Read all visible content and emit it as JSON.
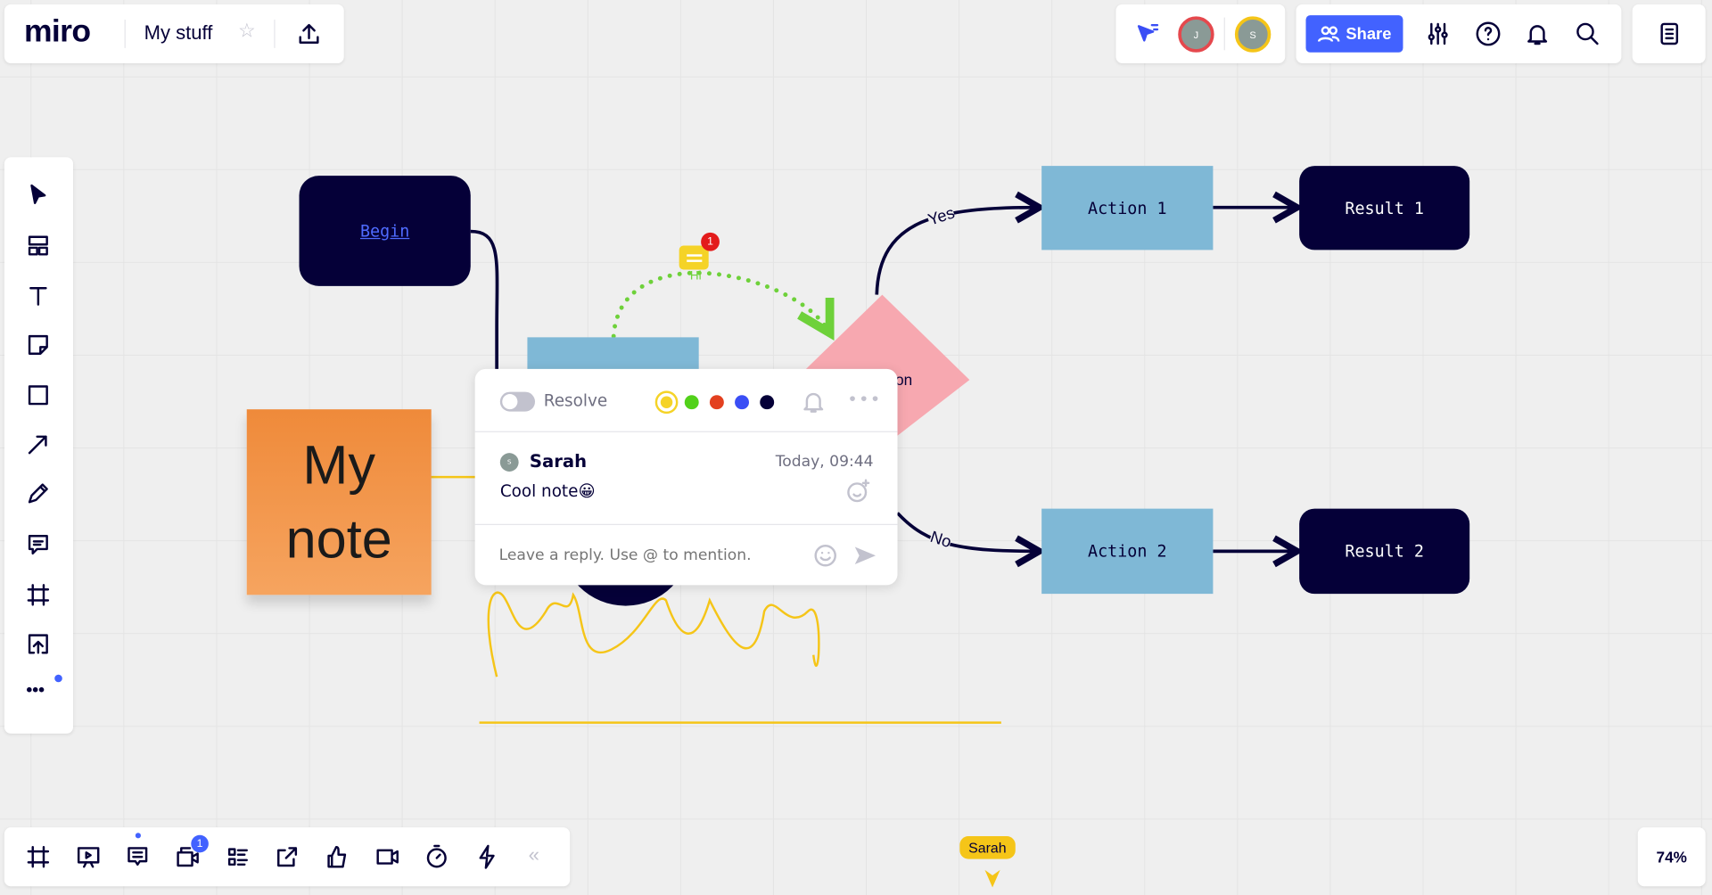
{
  "topbar": {
    "logo": "miro",
    "board_title": "My stuff",
    "star_icon": "star-icon",
    "export_icon": "upload-icon"
  },
  "collab": {
    "avatars": [
      {
        "initial": "J",
        "ring": "#e5484d"
      },
      {
        "initial": "S",
        "ring": "#f5c518"
      }
    ],
    "share_label": "Share"
  },
  "accent": "#4262ff",
  "left_toolbar": [
    "select",
    "templates",
    "text",
    "sticky-note",
    "shape",
    "arrow",
    "pen",
    "comment",
    "frame",
    "upload",
    "more"
  ],
  "bottom_toolbar": {
    "items": [
      "frame",
      "presentation",
      "comments",
      "video-chat",
      "card-list",
      "share-screen",
      "voting",
      "video",
      "timer",
      "lightning"
    ],
    "video_badge": "1"
  },
  "zoom": "74%",
  "canvas": {
    "begin": "Begin",
    "decision_partial": "on",
    "action1": "Action 1",
    "action2": "Action 2",
    "result1": "Result 1",
    "result2": "Result 2",
    "yes": "Yes",
    "no": "No",
    "hi": "Hi",
    "comment_badge": "1",
    "sticky": "My note"
  },
  "comment": {
    "resolve_label": "Resolve",
    "colors": [
      "#f5d327",
      "#52d11a",
      "#e3401f",
      "#3a4ef5",
      "#050038"
    ],
    "author": "Sarah",
    "author_initial": "S",
    "time": "Today, 09:44",
    "text": "Cool note😀",
    "reply_placeholder": "Leave a reply. Use @ to mention."
  },
  "cursor_label": "Sarah"
}
